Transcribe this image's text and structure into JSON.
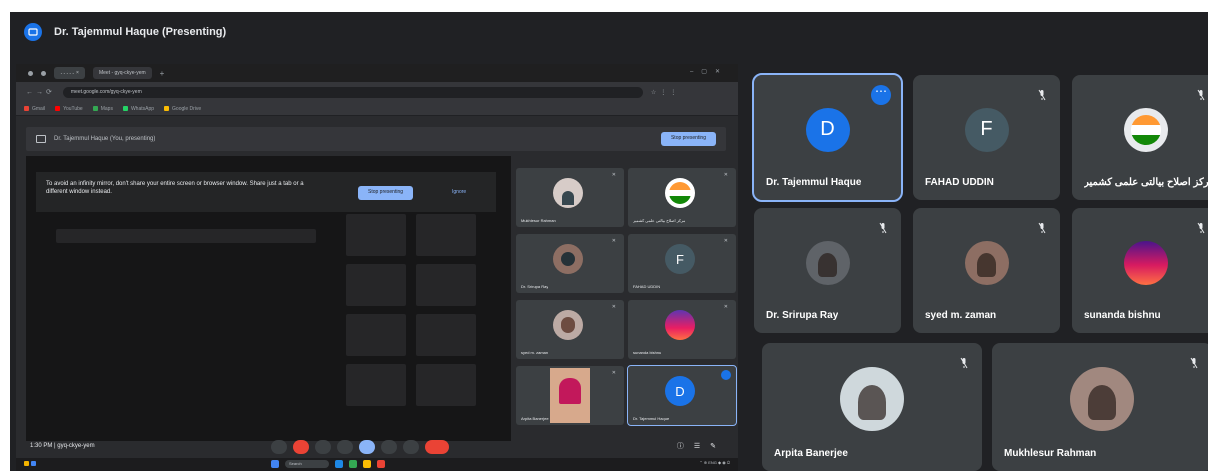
{
  "presenter": {
    "title": "Dr. Tajemmul Haque (Presenting)"
  },
  "shared_screen": {
    "tab_labels": [
      "۔۔۔۔۔ ×",
      "Meet - gyq-ckye-yem",
      "+"
    ],
    "address": "meet.google.com/gyq-ckye-yem",
    "bookmarks": [
      "Gmail",
      "YouTube",
      "Maps",
      "WhatsApp",
      "Google Drive"
    ],
    "presenting_bar": "Dr. Tajemmul Haque (You, presenting)",
    "stop_presenting": "Stop presenting",
    "warning": "To avoid an infinity mirror, don't share your entire screen or browser window. Share just a tab or a different window instead.",
    "warning_stop": "Stop presenting",
    "warning_ignore": "Ignore",
    "clock": "1:30 PM  |  gyq-ckye-yem",
    "tiles": [
      {
        "name": "Mukhlesur Rahman",
        "avatar": "photo"
      },
      {
        "name": "مرکز اصلاح بیالتی علمی کشمیر",
        "avatar": "logo"
      },
      {
        "name": "Dr. Srirupa Ray",
        "avatar": "photo"
      },
      {
        "name": "FAHAD UDDIN",
        "avatar": "F"
      },
      {
        "name": "syed m. zaman",
        "avatar": "photo"
      },
      {
        "name": "sunanda bishnu",
        "avatar": "sunset"
      },
      {
        "name": "Arpita Banerjee",
        "avatar": "photo"
      },
      {
        "name": "Dr. Tajemmul Haque",
        "avatar": "D"
      }
    ],
    "taskbar_search": "Search"
  },
  "participants": [
    {
      "name": "Dr. Tajemmul Haque",
      "initial": "D",
      "color": "#1a73e8",
      "speaking": true
    },
    {
      "name": "FAHAD UDDIN",
      "initial": "F",
      "color": "#455a64",
      "speaking": false
    },
    {
      "name": "مرکز اصلاح بیالتی علمی کشمیر",
      "initial": "",
      "color": "#e8eaed",
      "speaking": false
    },
    {
      "name": "Dr. Srirupa Ray",
      "initial": "",
      "color": "#5f6368",
      "speaking": false
    },
    {
      "name": "syed m. zaman",
      "initial": "",
      "color": "#8d6e63",
      "speaking": false
    },
    {
      "name": "sunanda bishnu",
      "initial": "",
      "color": "#7b1fa2",
      "speaking": false
    },
    {
      "name": "Arpita Banerjee",
      "initial": "",
      "color": "#cfd8dc",
      "speaking": false
    },
    {
      "name": "Mukhlesur Rahman",
      "initial": "",
      "color": "#a1887f",
      "speaking": false
    }
  ],
  "colors": {
    "accent": "#1a73e8",
    "tile_bg": "#3c4043",
    "meet_bg": "#202124",
    "end_call": "#ea4335"
  },
  "icons": [
    "present-icon",
    "mic-off-icon",
    "more-options-icon",
    "windows-start-icon"
  ]
}
